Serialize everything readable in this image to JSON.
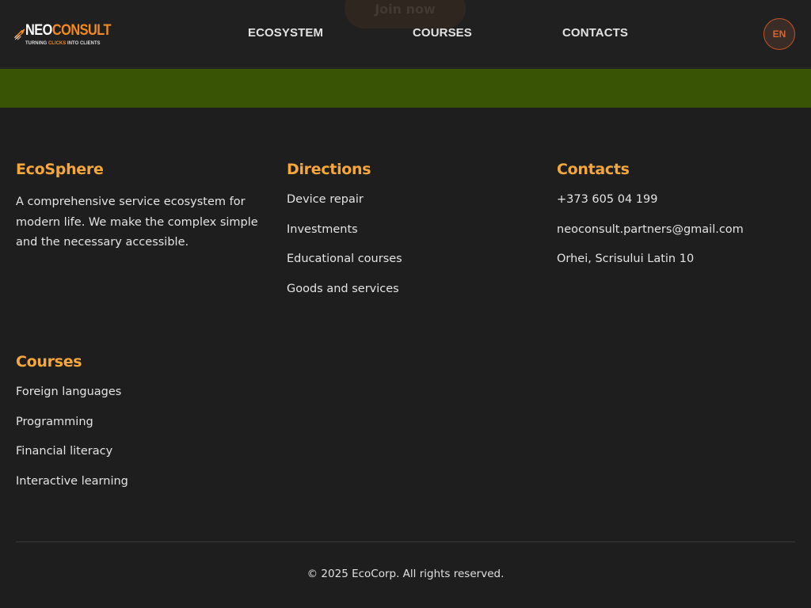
{
  "header": {
    "ghost_button_label": "Join now",
    "logo": {
      "word_part1": "NEO",
      "word_part2": "CONSULT",
      "tagline_part1": "TURNING ",
      "tagline_part2": "CLICKS",
      "tagline_part3": " INTO CLIENTS",
      "icon": "rocket-arrow-icon"
    },
    "nav": [
      {
        "label": "ECOSYSTEM"
      },
      {
        "label": "COURSES"
      },
      {
        "label": "CONTACTS"
      }
    ],
    "language": "EN"
  },
  "colors": {
    "background": "#1e1e1e",
    "accent_band": "#385404",
    "heading": "#f6a73a",
    "brand_orange": "#f28a1f",
    "lang_border": "#c4562a"
  },
  "footer": {
    "ecosphere": {
      "title": "EcoSphere",
      "description": "A comprehensive service ecosystem for modern life. We make the complex simple and the necessary accessible."
    },
    "directions": {
      "title": "Directions",
      "items": [
        "Device repair",
        "Investments",
        "Educational courses",
        "Goods and services"
      ]
    },
    "contacts": {
      "title": "Contacts",
      "items": [
        "+373 605 04 199",
        "neoconsult.partners@gmail.com",
        "Orhei, Scrisului Latin 10"
      ]
    },
    "courses": {
      "title": "Courses",
      "items": [
        "Foreign languages",
        "Programming",
        "Financial literacy",
        "Interactive learning"
      ]
    },
    "copyright": "© 2025 EcoCorp. All rights reserved."
  }
}
